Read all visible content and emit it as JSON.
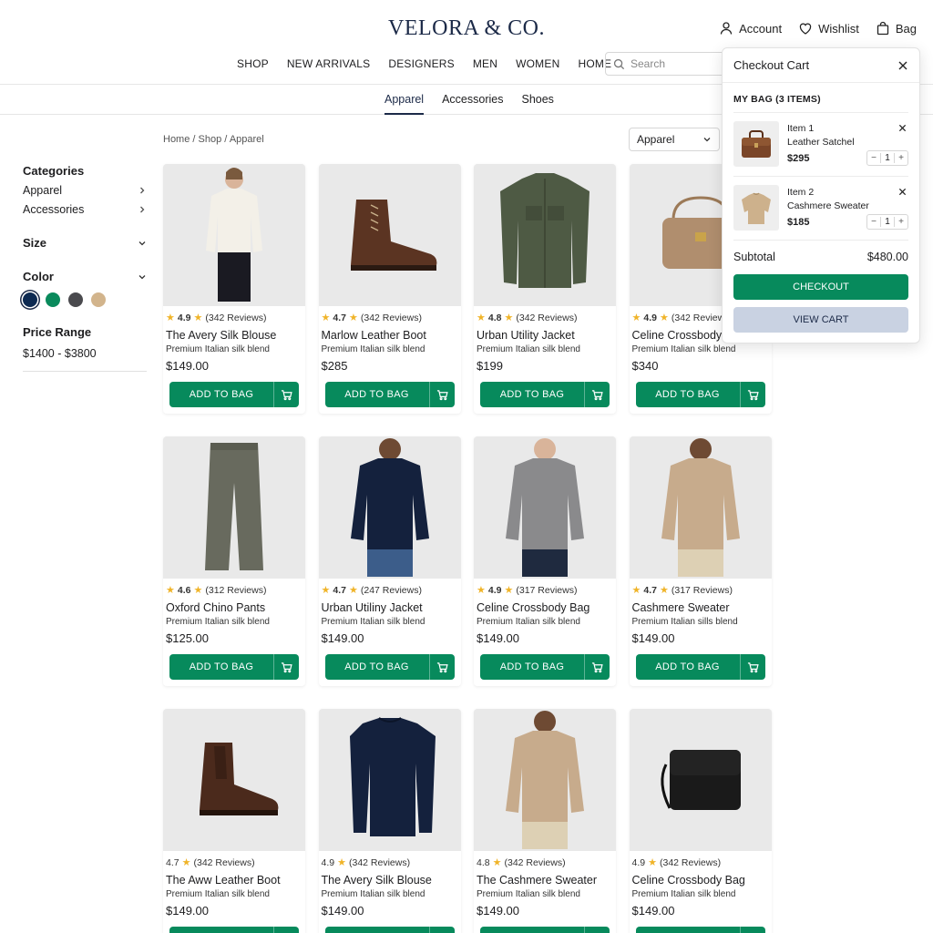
{
  "brand": "VELORA & CO.",
  "top_links": {
    "account": "Account",
    "wishlist": "Wishlist",
    "bag": "Bag"
  },
  "nav": [
    "SHOP",
    "NEW ARRIVALS",
    "DESIGNERS",
    "MEN",
    "WOMEN",
    "HOME"
  ],
  "search": {
    "placeholder": "Search"
  },
  "subtabs": [
    "Apparel",
    "Accessories",
    "Shoes"
  ],
  "breadcrumb": [
    "Home",
    "Shop",
    "Apparel"
  ],
  "sort": {
    "value": "Apparel"
  },
  "sidebar": {
    "categories_label": "Categories",
    "categories": [
      "Apparel",
      "Accessories"
    ],
    "size_label": "Size",
    "color_label": "Color",
    "colors": [
      "#0d2a52",
      "#0a8a5c",
      "#4a4a4e",
      "#d2b48c"
    ],
    "price_label": "Price Range",
    "price_value": "$1400 - $3800"
  },
  "add_label": "ADD TO BAG",
  "products": [
    {
      "rating": "4.9",
      "reviews": "(342 Reviews)",
      "name": "The Avery Silk Blouse",
      "desc": "Premium Italian silk blend",
      "price": "$149.00",
      "icon": "blouse"
    },
    {
      "rating": "4.7",
      "reviews": "(342 Reviews)",
      "name": "Marlow Leather Boot",
      "desc": "Premium Italian silk blend",
      "price": "$285",
      "icon": "boot"
    },
    {
      "rating": "4.8",
      "reviews": "(342 Reviews)",
      "name": "Urban Utility Jacket",
      "desc": "Premium Italian silk blend",
      "price": "$199",
      "icon": "jacket"
    },
    {
      "rating": "4.9",
      "reviews": "(342 Reviews)",
      "name": "Celine Crossbody",
      "desc": "Premium Italian silk blend",
      "price": "$340",
      "icon": "bag-tan"
    },
    {
      "rating": "4.6",
      "reviews": "(312 Reviews)",
      "name": "Oxford Chino Pants",
      "desc": "Premium Italian silk blend",
      "price": "$125.00",
      "icon": "pants"
    },
    {
      "rating": "4.7",
      "reviews": "(247 Reviews)",
      "name": "Urban Utiliny Jacket",
      "desc": "Premium Italian silk blend",
      "price": "$149.00",
      "icon": "sweater-navy"
    },
    {
      "rating": "4.9",
      "reviews": "(317 Reviews)",
      "name": "Celine Crossbody Bag",
      "desc": "Premium Italian silk blend",
      "price": "$149.00",
      "icon": "sweater-grey"
    },
    {
      "rating": "4.7",
      "reviews": "(317 Reviews)",
      "name": "Cashmere Sweater",
      "desc": "Premium Italian sills blend",
      "price": "$149.00",
      "icon": "sweater-beige"
    },
    {
      "rating": "4.7",
      "reviews": "(342 Reviews)",
      "name": "The Aww Leather Boot",
      "desc": "Premium Italian silk blend",
      "price": "$149.00",
      "icon": "chelsea",
      "rating_first": true
    },
    {
      "rating": "4.9",
      "reviews": "(342 Reviews)",
      "name": "The Avery Silk Blouse",
      "desc": "Premium Italian silk blend",
      "price": "$149.00",
      "icon": "sweater-navy-flat",
      "rating_first": true
    },
    {
      "rating": "4.8",
      "reviews": "(342 Reviews)",
      "name": "The Cashmere Sweater",
      "desc": "Premium Italian silk blend",
      "price": "$149.00",
      "icon": "sweater-beige",
      "rating_first": true
    },
    {
      "rating": "4.9",
      "reviews": "(342 Reviews)",
      "name": "Celine Crossbody Bag",
      "desc": "Premium Italian silk blend",
      "price": "$149.00",
      "icon": "bag-black",
      "rating_first": true
    }
  ],
  "cart": {
    "title": "Checkout Cart",
    "subtitle": "MY BAG (3 ITEMS)",
    "items": [
      {
        "label": "Item 1",
        "name": "Leather Satchel",
        "price": "$295",
        "qty": "1"
      },
      {
        "label": "Item 2",
        "name": "Cashmere Sweater",
        "price": "$185",
        "qty": "1"
      }
    ],
    "subtotal_label": "Subtotal",
    "subtotal_value": "$480.00",
    "checkout_label": "CHECKOUT",
    "view_label": "VIEW CART"
  },
  "colors": {
    "accent_green": "#078a5c",
    "navy": "#1c2a48",
    "view_cart_bg": "#c9d2e2"
  }
}
